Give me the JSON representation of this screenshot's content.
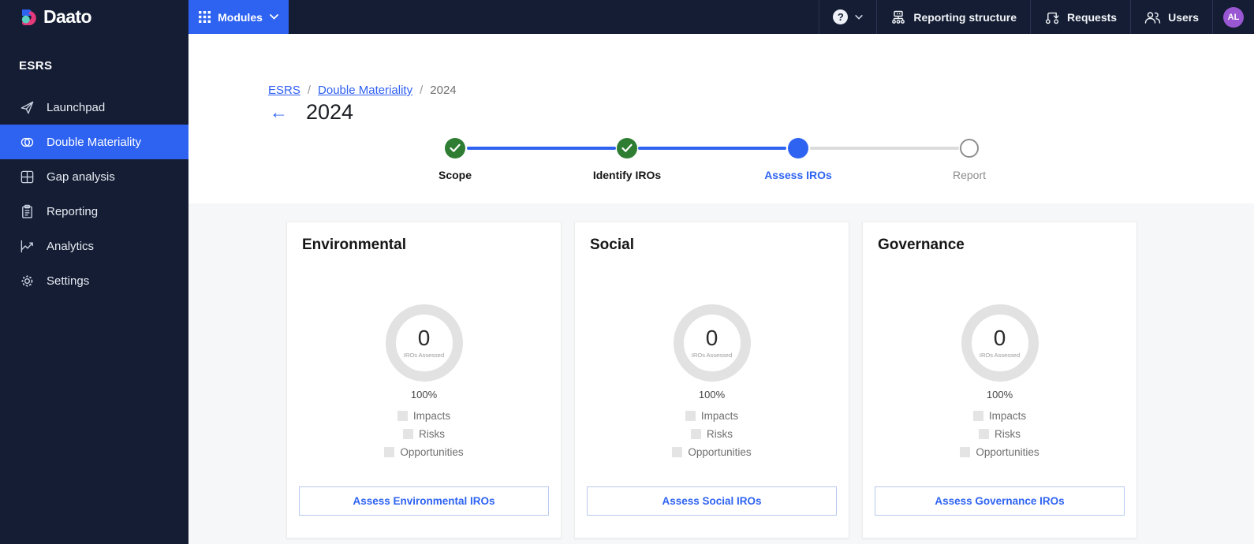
{
  "topbar": {
    "logo_text": "Daato",
    "modules_label": "Modules",
    "help_glyph": "?",
    "nav": [
      {
        "label": "Reporting structure",
        "icon": "org-chart-icon"
      },
      {
        "label": "Requests",
        "icon": "workflow-arrow-icon"
      },
      {
        "label": "Users",
        "icon": "people-icon"
      }
    ],
    "avatar_initials": "AL"
  },
  "sidebar": {
    "section_title": "ESRS",
    "items": [
      {
        "label": "Launchpad",
        "icon": "paper-plane-icon",
        "active": false
      },
      {
        "label": "Double Materiality",
        "icon": "overlapping-circles-icon",
        "active": true
      },
      {
        "label": "Gap analysis",
        "icon": "grid-squares-icon",
        "active": false
      },
      {
        "label": "Reporting",
        "icon": "clipboard-icon",
        "active": false
      },
      {
        "label": "Analytics",
        "icon": "line-chart-icon",
        "active": false
      },
      {
        "label": "Settings",
        "icon": "gear-icon",
        "active": false
      }
    ]
  },
  "breadcrumb": {
    "links": [
      "ESRS",
      "Double Materiality"
    ],
    "current": "2024",
    "separator": "/"
  },
  "page": {
    "title": "2024",
    "back_glyph": "←"
  },
  "stepper": {
    "steps": [
      {
        "label": "Scope",
        "state": "completed"
      },
      {
        "label": "Identify IROs",
        "state": "completed"
      },
      {
        "label": "Assess IROs",
        "state": "active"
      },
      {
        "label": "Report",
        "state": "upcoming"
      }
    ]
  },
  "cards": [
    {
      "title": "Environmental",
      "count": "0",
      "count_label": "IROs Assessed",
      "percent": "100%",
      "legend": [
        "Impacts",
        "Risks",
        "Opportunities"
      ],
      "button_label": "Assess Environmental IROs"
    },
    {
      "title": "Social",
      "count": "0",
      "count_label": "IROs Assessed",
      "percent": "100%",
      "legend": [
        "Impacts",
        "Risks",
        "Opportunities"
      ],
      "button_label": "Assess Social IROs"
    },
    {
      "title": "Governance",
      "count": "0",
      "count_label": "IROs Assessed",
      "percent": "100%",
      "legend": [
        "Impacts",
        "Risks",
        "Opportunities"
      ],
      "button_label": "Assess Governance IROs"
    }
  ],
  "colors": {
    "topbar_bg": "#141d33",
    "accent_blue": "#2e63f2",
    "success_green": "#2e7d32",
    "avatar_purple": "#9a57d3",
    "page_bg": "#f6f7f9",
    "donut_ring_gray": "#e2e2e2"
  }
}
